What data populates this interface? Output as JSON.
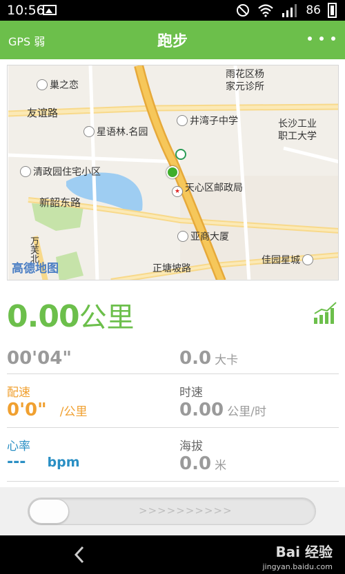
{
  "status_bar": {
    "time": "10:56",
    "battery": "86"
  },
  "header": {
    "gps_label": "GPS 弱",
    "title": "跑步"
  },
  "map": {
    "watermark": "高德地图",
    "labels": {
      "l1": "巢之恋",
      "l2": "雨花区杨",
      "l3": "家元诊所",
      "l4": "友谊路",
      "l5": "井湾子中学",
      "l6": "长沙工业",
      "l7": "职工大学",
      "l8": "星语林.名园",
      "l9": "清政园住宅小区",
      "l10": "天心区邮政局",
      "l11": "新韶东路",
      "l12": "亚商大厦",
      "l13": "万芙北",
      "l14": "佳园星城",
      "l15": "正塘坡路"
    }
  },
  "stats": {
    "distance_value": "0.00",
    "distance_unit": "公里",
    "duration": "00'04\"",
    "calories_value": "0.0",
    "calories_unit": "大卡",
    "pace_label": "配速",
    "pace_value": "0'0\"",
    "pace_unit": "/公里",
    "speed_label": "时速",
    "speed_value": "0.00",
    "speed_unit": "公里/时",
    "heart_label": "心率",
    "heart_value": "---",
    "heart_unit": "bpm",
    "altitude_label": "海拔",
    "altitude_value": "0.0",
    "altitude_unit": "米"
  },
  "slider": {
    "hint": ">>>>>>>>>>"
  },
  "watermark": {
    "brand": "Bai 经验",
    "url": "jingyan.baidu.com"
  },
  "colors": {
    "accent": "#6cbf4b",
    "pace": "#f0a030",
    "heart": "#2a8fc4"
  }
}
